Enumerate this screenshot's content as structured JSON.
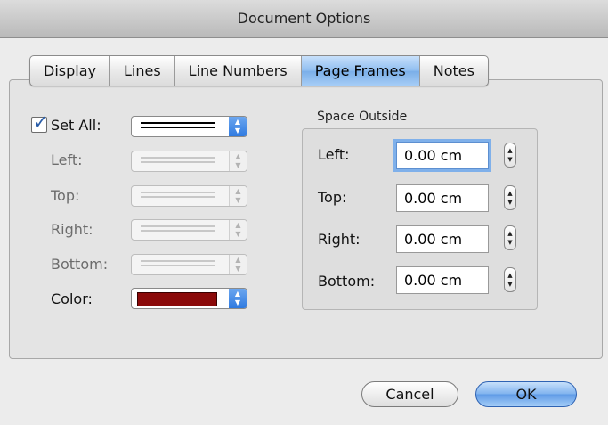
{
  "window": {
    "title": "Document Options"
  },
  "tabs": [
    {
      "label": "Display",
      "active": false
    },
    {
      "label": "Lines",
      "active": false
    },
    {
      "label": "Line Numbers",
      "active": false
    },
    {
      "label": "Page Frames",
      "active": true
    },
    {
      "label": "Notes",
      "active": false
    }
  ],
  "frames": {
    "set_all": {
      "label": "Set All:",
      "checked": true
    },
    "left_label": "Left:",
    "top_label": "Top:",
    "right_label": "Right:",
    "bottom_label": "Bottom:",
    "color_label": "Color:",
    "color_value": "#8b0a0a",
    "accent_color": "#3b82e6"
  },
  "space_outside": {
    "title": "Space Outside",
    "fields": [
      {
        "label": "Left:",
        "value": "0.00 cm"
      },
      {
        "label": "Top:",
        "value": "0.00 cm"
      },
      {
        "label": "Right:",
        "value": "0.00 cm"
      },
      {
        "label": "Bottom:",
        "value": "0.00 cm"
      }
    ]
  },
  "buttons": {
    "cancel": "Cancel",
    "ok": "OK"
  }
}
